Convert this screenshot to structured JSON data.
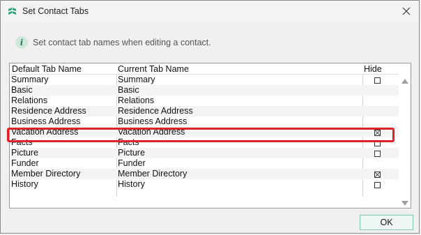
{
  "window": {
    "title": "Set Contact Tabs"
  },
  "info": {
    "text": "Set contact tab names when editing a contact."
  },
  "table": {
    "headers": {
      "default": "Default Tab Name",
      "current": "Current Tab Name",
      "hide": "Hide"
    },
    "rows": [
      {
        "default": "Summary",
        "current": "Summary",
        "hide": false,
        "show_checkbox": true
      },
      {
        "default": "Basic",
        "current": "Basic",
        "hide": false,
        "show_checkbox": false
      },
      {
        "default": "Relations",
        "current": "Relations",
        "hide": false,
        "show_checkbox": false
      },
      {
        "default": "Residence Address",
        "current": "Residence Address",
        "hide": false,
        "show_checkbox": false
      },
      {
        "default": "Business Address",
        "current": "Business Address",
        "hide": false,
        "show_checkbox": false
      },
      {
        "default": "Vacation Address",
        "current": "Vacation Address",
        "hide": true,
        "show_checkbox": true
      },
      {
        "default": "Facts",
        "current": "Facts",
        "hide": false,
        "show_checkbox": true
      },
      {
        "default": "Picture",
        "current": "Picture",
        "hide": false,
        "show_checkbox": true
      },
      {
        "default": "Funder",
        "current": "Funder",
        "hide": false,
        "show_checkbox": false
      },
      {
        "default": "Member Directory",
        "current": "Member Directory",
        "hide": true,
        "show_checkbox": true
      },
      {
        "default": "History",
        "current": "History",
        "hide": false,
        "show_checkbox": true
      }
    ]
  },
  "buttons": {
    "ok": "OK"
  },
  "colors": {
    "highlight": "#e0202a",
    "accent": "#2f9e7a"
  }
}
